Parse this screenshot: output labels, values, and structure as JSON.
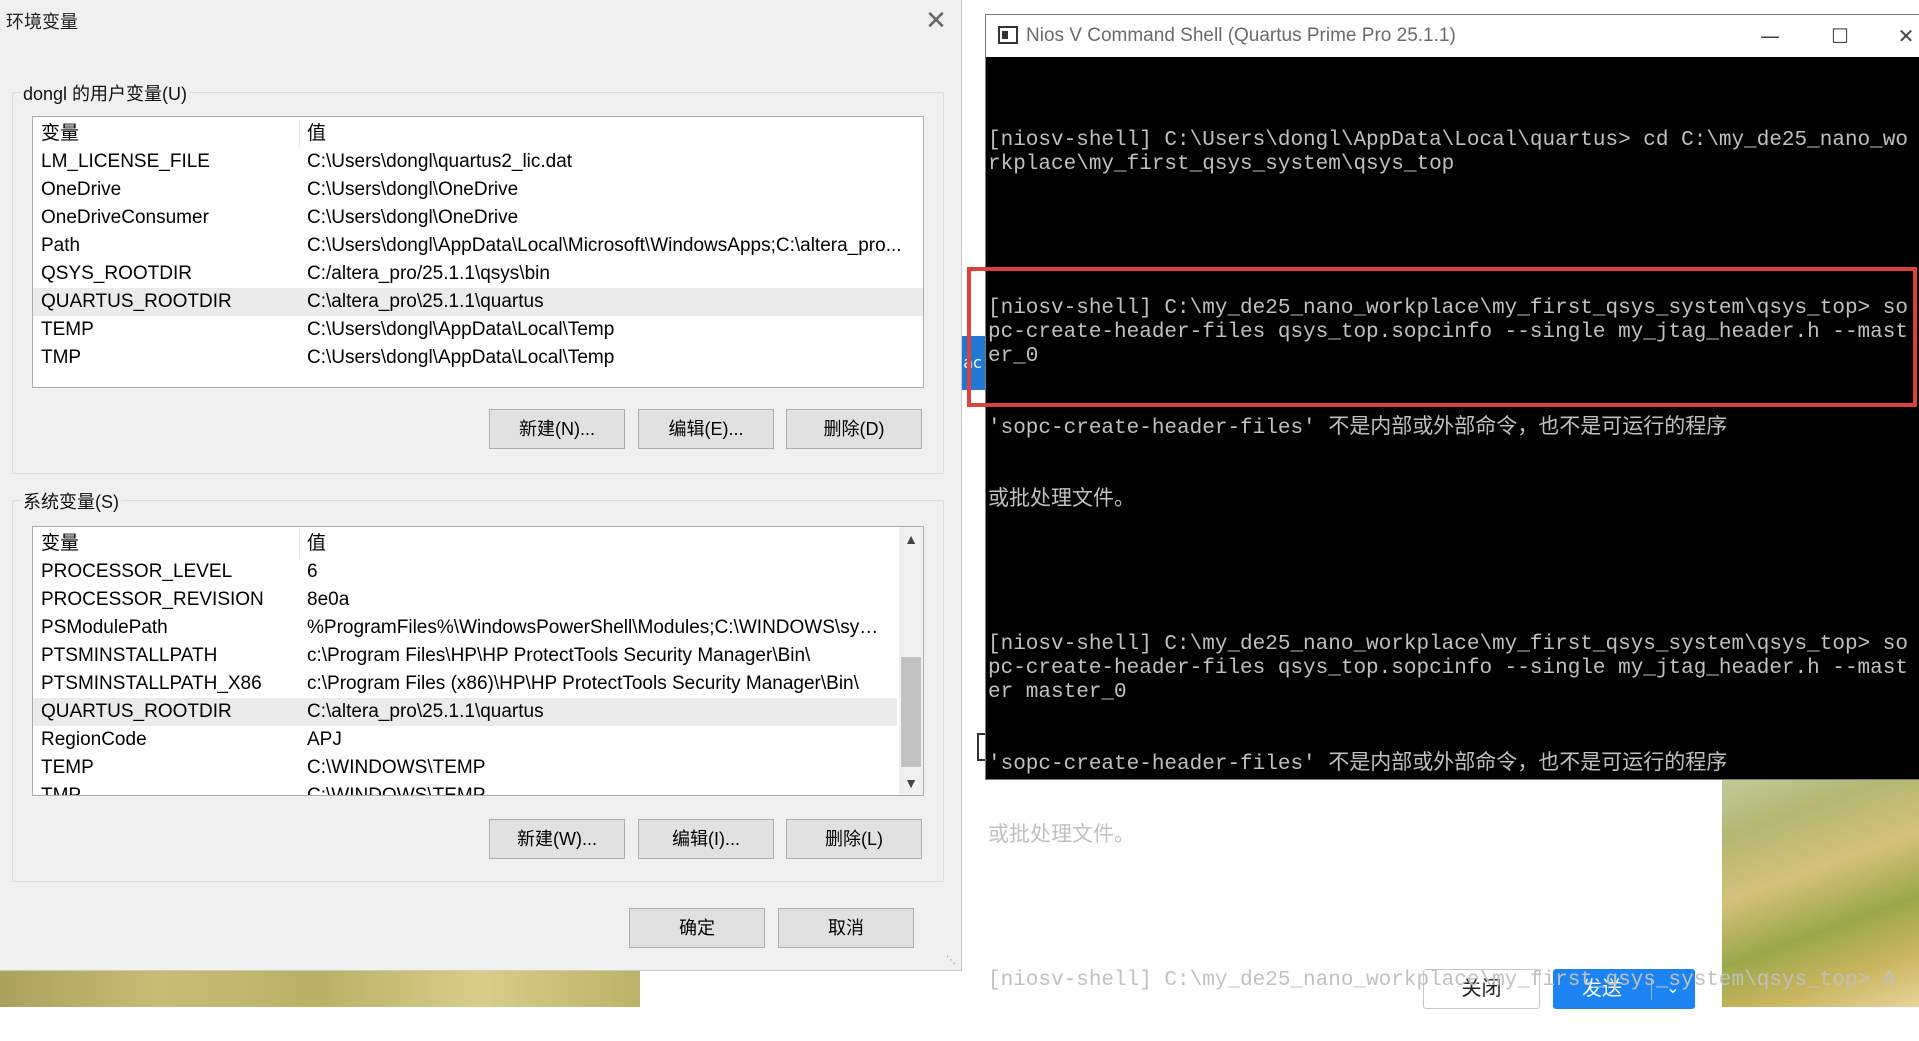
{
  "dialog": {
    "title": "环境变量",
    "user_vars": {
      "label": "dongl 的用户变量(U)",
      "col_variable": "变量",
      "col_value": "值",
      "rows": [
        {
          "name": "LM_LICENSE_FILE",
          "value": "C:\\Users\\dongl\\quartus2_lic.dat"
        },
        {
          "name": "OneDrive",
          "value": "C:\\Users\\dongl\\OneDrive"
        },
        {
          "name": "OneDriveConsumer",
          "value": "C:\\Users\\dongl\\OneDrive"
        },
        {
          "name": "Path",
          "value": "C:\\Users\\dongl\\AppData\\Local\\Microsoft\\WindowsApps;C:\\altera_pro..."
        },
        {
          "name": "QSYS_ROOTDIR",
          "value": "C:/altera_pro/25.1.1\\qsys\\bin"
        },
        {
          "name": "QUARTUS_ROOTDIR",
          "value": "C:\\altera_pro\\25.1.1\\quartus"
        },
        {
          "name": "TEMP",
          "value": "C:\\Users\\dongl\\AppData\\Local\\Temp"
        },
        {
          "name": "TMP",
          "value": "C:\\Users\\dongl\\AppData\\Local\\Temp"
        }
      ],
      "buttons": {
        "new": "新建(N)...",
        "edit": "编辑(E)...",
        "delete": "删除(D)"
      }
    },
    "system_vars": {
      "label": "系统变量(S)",
      "col_variable": "变量",
      "col_value": "值",
      "rows": [
        {
          "name": "PROCESSOR_LEVEL",
          "value": "6"
        },
        {
          "name": "PROCESSOR_REVISION",
          "value": "8e0a"
        },
        {
          "name": "PSModulePath",
          "value": "%ProgramFiles%\\WindowsPowerShell\\Modules;C:\\WINDOWS\\syst..."
        },
        {
          "name": "PTSMINSTALLPATH",
          "value": "c:\\Program Files\\HP\\HP ProtectTools Security Manager\\Bin\\"
        },
        {
          "name": "PTSMINSTALLPATH_X86",
          "value": "c:\\Program Files (x86)\\HP\\HP ProtectTools Security Manager\\Bin\\"
        },
        {
          "name": "QUARTUS_ROOTDIR",
          "value": "C:\\altera_pro\\25.1.1\\quartus"
        },
        {
          "name": "RegionCode",
          "value": "APJ"
        },
        {
          "name": "TEMP",
          "value": "C:\\WINDOWS\\TEMP"
        },
        {
          "name": "TMP",
          "value": "C:\\WINDOWS\\TEMP"
        }
      ],
      "buttons": {
        "new": "新建(W)...",
        "edit": "编辑(I)...",
        "delete": "删除(L)"
      }
    },
    "ok": "确定",
    "cancel": "取消"
  },
  "terminal": {
    "title": "Nios V Command Shell (Quartus Prime Pro 25.1.1)",
    "lines": [
      "[niosv-shell] C:\\Users\\dongl\\AppData\\Local\\quartus> cd C:\\my_de25_nano_workplace\\my_first_qsys_system\\qsys_top",
      "",
      "[niosv-shell] C:\\my_de25_nano_workplace\\my_first_qsys_system\\qsys_top> sopc-create-header-files qsys_top.sopcinfo --single my_jtag_header.h --master_0",
      "'sopc-create-header-files' 不是内部或外部命令，也不是可运行的程序",
      "或批处理文件。",
      "",
      "[niosv-shell] C:\\my_de25_nano_workplace\\my_first_qsys_system\\qsys_top> sopc-create-header-files qsys_top.sopcinfo --single my_jtag_header.h --master master_0",
      "'sopc-create-header-files' 不是内部或外部命令，也不是可运行的程序",
      "或批处理文件。",
      "",
      "[niosv-shell] C:\\my_de25_nano_workplace\\my_first_qsys_system\\qsys_top> A"
    ]
  },
  "background_app": {
    "close_label": "关闭",
    "send_label": "发送"
  },
  "colors": {
    "highlight": "#e0403a",
    "send_button": "#1c84f2",
    "terminal_bg": "#000000",
    "terminal_text": "#c0c0c0"
  }
}
